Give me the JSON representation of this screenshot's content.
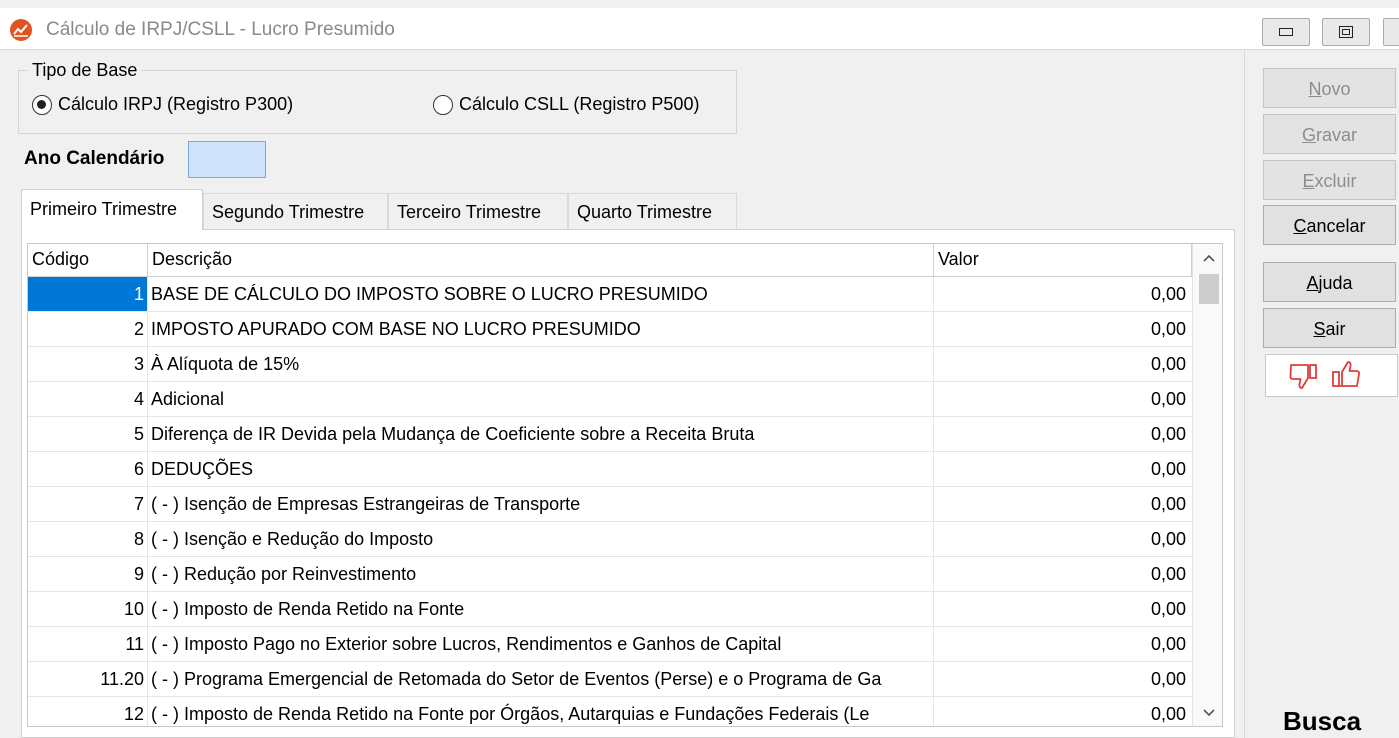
{
  "window": {
    "title": "Cálculo de IRPJ/CSLL - Lucro Presumido"
  },
  "tipo_base": {
    "legend": "Tipo de Base",
    "options": [
      {
        "label": "Cálculo IRPJ (Registro P300)",
        "checked": true
      },
      {
        "label": "Cálculo CSLL (Registro P500)",
        "checked": false
      }
    ]
  },
  "ano": {
    "label": "Ano Calendário",
    "value": ""
  },
  "tabs": [
    {
      "label": "Primeiro Trimestre",
      "active": true
    },
    {
      "label": "Segundo Trimestre",
      "active": false
    },
    {
      "label": "Terceiro Trimestre",
      "active": false
    },
    {
      "label": "Quarto Trimestre",
      "active": false
    }
  ],
  "grid": {
    "columns": [
      "Código",
      "Descrição",
      "Valor"
    ],
    "rows": [
      {
        "codigo": "1",
        "descricao": "BASE DE CÁLCULO DO IMPOSTO SOBRE O LUCRO PRESUMIDO",
        "valor": "0,00"
      },
      {
        "codigo": "2",
        "descricao": "IMPOSTO APURADO COM BASE NO LUCRO PRESUMIDO",
        "valor": "0,00"
      },
      {
        "codigo": "3",
        "descricao": "À Alíquota de 15%",
        "valor": "0,00"
      },
      {
        "codigo": "4",
        "descricao": "Adicional",
        "valor": "0,00"
      },
      {
        "codigo": "5",
        "descricao": "Diferença de IR Devida pela Mudança de Coeficiente sobre a Receita Bruta",
        "valor": "0,00"
      },
      {
        "codigo": "6",
        "descricao": "DEDUÇÕES",
        "valor": "0,00"
      },
      {
        "codigo": "7",
        "descricao": "( - ) Isenção de Empresas Estrangeiras de Transporte",
        "valor": "0,00"
      },
      {
        "codigo": "8",
        "descricao": "( - ) Isenção e Redução do Imposto",
        "valor": "0,00"
      },
      {
        "codigo": "9",
        "descricao": "( - ) Redução por Reinvestimento",
        "valor": "0,00"
      },
      {
        "codigo": "10",
        "descricao": "( - ) Imposto de Renda Retido na Fonte",
        "valor": "0,00"
      },
      {
        "codigo": "11",
        "descricao": "( - ) Imposto Pago no Exterior sobre Lucros, Rendimentos e Ganhos de Capital",
        "valor": "0,00"
      },
      {
        "codigo": "11.20",
        "descricao": "( - ) Programa Emergencial de Retomada do Setor de Eventos (Perse) e o Programa de Ga",
        "valor": "0,00"
      },
      {
        "codigo": "12",
        "descricao": "( - ) Imposto de Renda Retido na Fonte por Órgãos, Autarquias e Fundações Federais (Le",
        "valor": "0,00"
      }
    ]
  },
  "sidebar": {
    "novo": {
      "prefix": "",
      "accel": "N",
      "rest": "ovo"
    },
    "gravar": {
      "prefix": "",
      "accel": "G",
      "rest": "ravar"
    },
    "excluir": {
      "prefix": "",
      "accel": "E",
      "rest": "xcluir"
    },
    "cancelar": {
      "prefix": "",
      "accel": "C",
      "rest": "ancelar"
    },
    "ajuda": {
      "prefix": "",
      "accel": "A",
      "rest": "juda"
    },
    "sair": {
      "prefix": "",
      "accel": "S",
      "rest": "air"
    },
    "busca_label": "Busca"
  },
  "colors": {
    "selected_cell": "#0078d7",
    "app_icon": "#e0521f",
    "feedback_icons": "#e03c3c"
  },
  "icons": [
    "app-chart-icon",
    "minimize-icon",
    "restore-icon",
    "scroll-up-icon",
    "scroll-down-icon",
    "thumbs-down-icon",
    "thumbs-up-icon"
  ]
}
